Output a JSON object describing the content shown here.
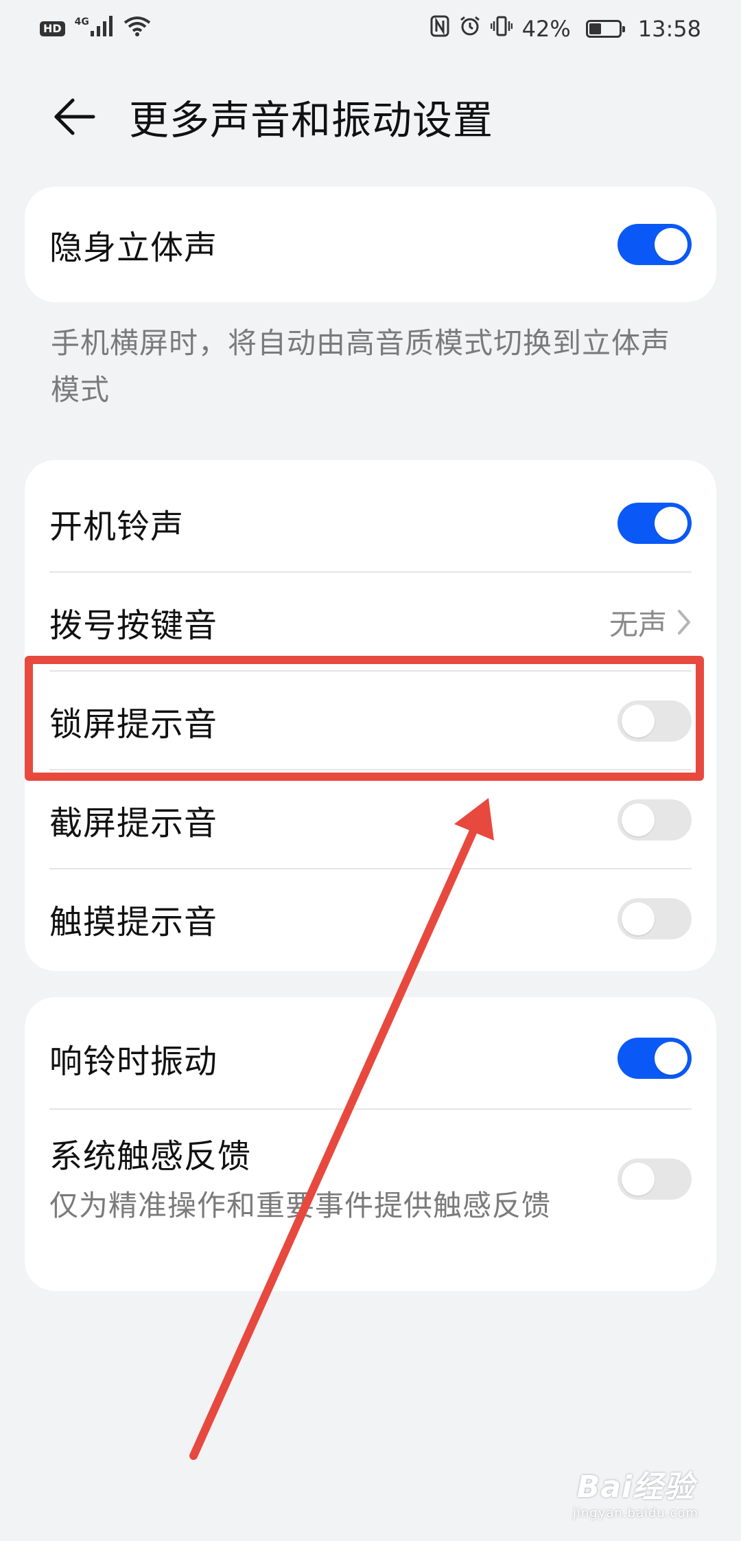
{
  "status_bar": {
    "hd": "HD",
    "network": "4G",
    "battery_percent": "42%",
    "battery_level": 0.42,
    "time": "13:58",
    "icons": [
      "signal-icon",
      "wifi-icon",
      "nfc-icon",
      "alarm-icon",
      "vibrate-icon",
      "battery-icon"
    ]
  },
  "header": {
    "back_icon": "back-arrow-icon",
    "title": "更多声音和振动设置"
  },
  "stereo_card": {
    "label": "隐身立体声",
    "toggle": "on",
    "hint": "手机横屏时，将自动由高音质模式切换到立体声模式"
  },
  "sound_card": {
    "items": [
      {
        "label": "开机铃声",
        "type": "toggle",
        "state": "on"
      },
      {
        "label": "拨号按键音",
        "type": "value",
        "value": "无声"
      },
      {
        "label": "锁屏提示音",
        "type": "toggle",
        "state": "off"
      },
      {
        "label": "截屏提示音",
        "type": "toggle",
        "state": "off"
      },
      {
        "label": "触摸提示音",
        "type": "toggle",
        "state": "off"
      }
    ]
  },
  "vibration_card": {
    "items": [
      {
        "label": "响铃时振动",
        "type": "toggle",
        "state": "on"
      },
      {
        "label": "系统触感反馈",
        "sub": "仅为精准操作和重要事件提供触感反馈",
        "type": "toggle",
        "state": "off"
      }
    ]
  },
  "watermark": {
    "brand": "Bai经验",
    "url": "jingyan.baidu.com"
  },
  "colors": {
    "accent": "#0a59f7",
    "annotation": "#e8493e",
    "background": "#f1f3f5"
  }
}
